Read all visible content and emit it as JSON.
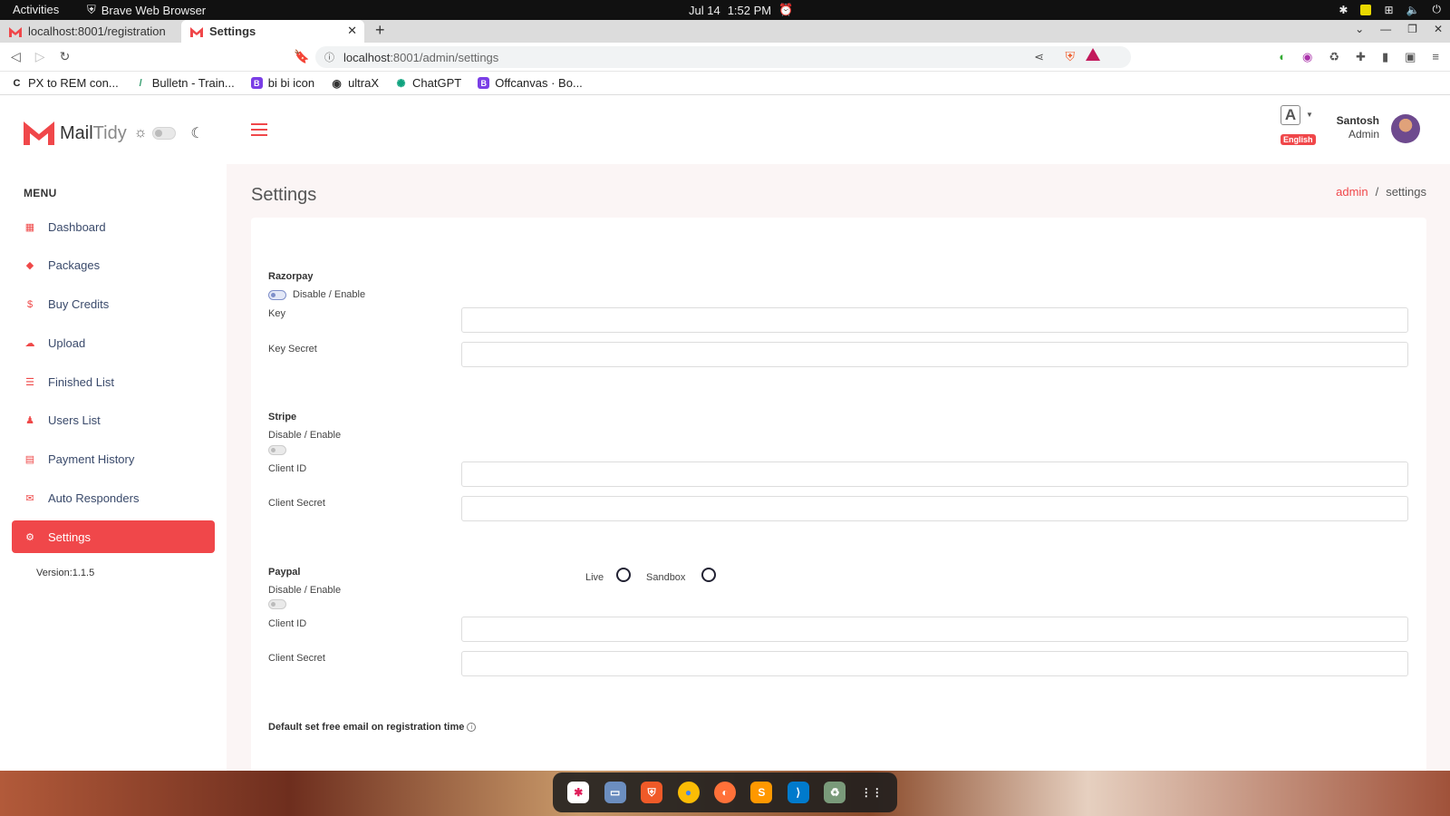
{
  "system": {
    "activities": "Activities",
    "app_name": "Brave Web Browser",
    "clock_date": "Jul 14",
    "clock_time": "1:52 PM"
  },
  "browser": {
    "tabs": [
      {
        "label": "localhost:8001/registration"
      },
      {
        "label": "Settings"
      }
    ],
    "url_host": "localhost",
    "url_path": ":8001/admin/settings",
    "bookmarks": [
      {
        "label": "PX to REM con...",
        "icon": "C",
        "color": "#222222"
      },
      {
        "label": "Bulletn - Train...",
        "icon": "/",
        "color": "#2e9a6a"
      },
      {
        "label": "bi bi icon",
        "icon": "B",
        "color": "#7a3ee6"
      },
      {
        "label": "ultraX",
        "icon": "◉",
        "color": "#333333"
      },
      {
        "label": "ChatGPT",
        "icon": "✺",
        "color": "#10a37f"
      },
      {
        "label": "Offcanvas · Bo...",
        "icon": "B",
        "color": "#7a3ee6"
      }
    ]
  },
  "brand": {
    "name_bold": "Mail",
    "name_light": "Tidy",
    "accent": "#f0474a"
  },
  "sidebar": {
    "menu_title": "MENU",
    "items": [
      {
        "label": "Dashboard",
        "icon": "▦",
        "icon_name": "dashboard-icon"
      },
      {
        "label": "Packages",
        "icon": "◆",
        "icon_name": "tag-icon"
      },
      {
        "label": "Buy Credits",
        "icon": "$",
        "icon_name": "dollar-icon"
      },
      {
        "label": "Upload",
        "icon": "☁",
        "icon_name": "cloud-upload-icon"
      },
      {
        "label": "Finished List",
        "icon": "☰",
        "icon_name": "list-icon"
      },
      {
        "label": "Users List",
        "icon": "♟",
        "icon_name": "users-icon"
      },
      {
        "label": "Payment History",
        "icon": "▤",
        "icon_name": "receipt-icon"
      },
      {
        "label": "Auto Responders",
        "icon": "✉",
        "icon_name": "mail-icon"
      },
      {
        "label": "Settings",
        "icon": "⚙",
        "icon_name": "gear-icon"
      }
    ],
    "version": "Version:1.1.5"
  },
  "header": {
    "language_badge": "English",
    "user_name": "Santosh",
    "user_role": "Admin"
  },
  "page": {
    "title": "Settings",
    "breadcrumb_link": "admin",
    "breadcrumb_sep": "/",
    "breadcrumb_current": "settings"
  },
  "razorpay": {
    "title": "Razorpay",
    "toggle_label": "Disable / Enable",
    "key_label": "Key",
    "key_value": "",
    "secret_label": "Key Secret",
    "secret_value": ""
  },
  "stripe": {
    "title": "Stripe",
    "toggle_label": "Disable / Enable",
    "client_id_label": "Client ID",
    "client_id_value": "",
    "client_secret_label": "Client Secret",
    "client_secret_value": ""
  },
  "paypal": {
    "title": "Paypal",
    "toggle_label": "Disable / Enable",
    "live_label": "Live",
    "sandbox_label": "Sandbox",
    "client_id_label": "Client ID",
    "client_id_value": "",
    "client_secret_label": "Client Secret",
    "client_secret_value": ""
  },
  "free_email": {
    "title": "Default set free email on registration time"
  }
}
